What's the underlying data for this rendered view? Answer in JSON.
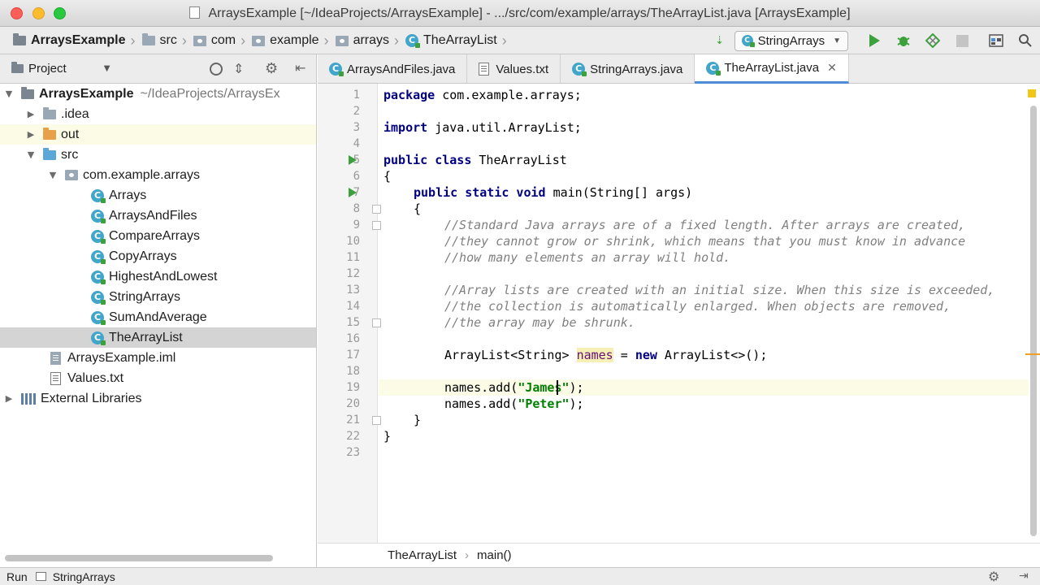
{
  "window": {
    "title": "ArraysExample [~/IdeaProjects/ArraysExample] - .../src/com/example/arrays/TheArrayList.java [ArraysExample]"
  },
  "breadcrumb": [
    "ArraysExample",
    "src",
    "com",
    "example",
    "arrays",
    "TheArrayList"
  ],
  "toolbar": {
    "run_config": "StringArrays"
  },
  "project_panel": {
    "title": "Project",
    "tree": [
      {
        "label": "ArraysExample",
        "hint": "~/IdeaProjects/ArraysEx"
      },
      {
        "label": ".idea"
      },
      {
        "label": "out"
      },
      {
        "label": "src"
      },
      {
        "label": "com.example.arrays"
      },
      {
        "label": "Arrays"
      },
      {
        "label": "ArraysAndFiles"
      },
      {
        "label": "CompareArrays"
      },
      {
        "label": "CopyArrays"
      },
      {
        "label": "HighestAndLowest"
      },
      {
        "label": "StringArrays"
      },
      {
        "label": "SumAndAverage"
      },
      {
        "label": "TheArrayList"
      },
      {
        "label": "ArraysExample.iml"
      },
      {
        "label": "Values.txt"
      },
      {
        "label": "External Libraries"
      }
    ]
  },
  "tabs": [
    {
      "label": "ArraysAndFiles.java"
    },
    {
      "label": "Values.txt"
    },
    {
      "label": "StringArrays.java"
    },
    {
      "label": "TheArrayList.java"
    }
  ],
  "editor": {
    "line_numbers": [
      "1",
      "2",
      "3",
      "4",
      "5",
      "6",
      "7",
      "8",
      "9",
      "10",
      "11",
      "12",
      "13",
      "14",
      "15",
      "16",
      "17",
      "18",
      "19",
      "20",
      "21",
      "22",
      "23"
    ],
    "code": {
      "l1_kw": "package",
      "l1_rest": " com.example.arrays;",
      "l3_kw": "import",
      "l3_rest": " java.util.ArrayList;",
      "l5_kw": "public class",
      "l5_rest": " TheArrayList",
      "l6": "{",
      "l7_kw": "public static void",
      "l7_rest": " main(String[] args)",
      "l8": "{",
      "l9": "//Standard Java arrays are of a fixed length. After arrays are created,",
      "l10": "//they cannot grow or shrink, which means that you must know in advance",
      "l11": "//how many elements an array will hold.",
      "l13": "//Array lists are created with an initial size. When this size is exceeded,",
      "l14": "//the collection is automatically enlarged. When objects are removed,",
      "l15": "//the array may be shrunk.",
      "l17_a": "ArrayList<String> ",
      "l17_var": "names",
      "l17_b": " = ",
      "l17_kw": "new",
      "l17_c": " ArrayList<>();",
      "l19_a": "names.add(",
      "l19_str": "\"James\"",
      "l19_b": ");",
      "l20_a": "names.add(",
      "l20_str": "\"Peter\"",
      "l20_b": ");",
      "l21": "}",
      "l22": "}"
    }
  },
  "code_breadcrumb": [
    "TheArrayList",
    "main()"
  ],
  "statusbar": {
    "run_label": "Run",
    "run_target": "StringArrays"
  },
  "colors": {
    "accent": "#4e8cd6",
    "keyword": "#000080",
    "string": "#008000",
    "comment": "#808080"
  }
}
